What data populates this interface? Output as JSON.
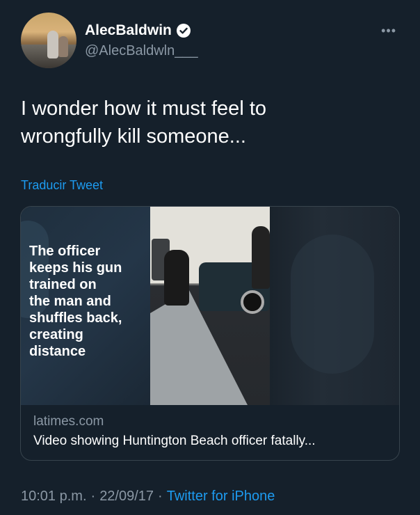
{
  "author": {
    "display_name": "AlecBaldwin",
    "handle": "@AlecBaldwln___",
    "verified": true,
    "avatar_icon": "profile-photo"
  },
  "more_icon": "more-options-icon",
  "tweet": {
    "text": "I wonder how it must feel to\nwrongfully kill someone...",
    "translate_label": "Traducir Tweet"
  },
  "card": {
    "overlay_text": "The officer\nkeeps his gun\ntrained on\nthe man and\nshuffles back,\ncreating\ndistance",
    "domain": "latimes.com",
    "title": "Video showing Huntington Beach officer fatally..."
  },
  "footer": {
    "time": "10:01 p.m.",
    "separator1": "·",
    "date": "22/09/17",
    "separator2": "·",
    "source": "Twitter for iPhone"
  },
  "colors": {
    "background": "#15202b",
    "accent": "#1d9bf0",
    "secondary_text": "#8b98a5"
  }
}
